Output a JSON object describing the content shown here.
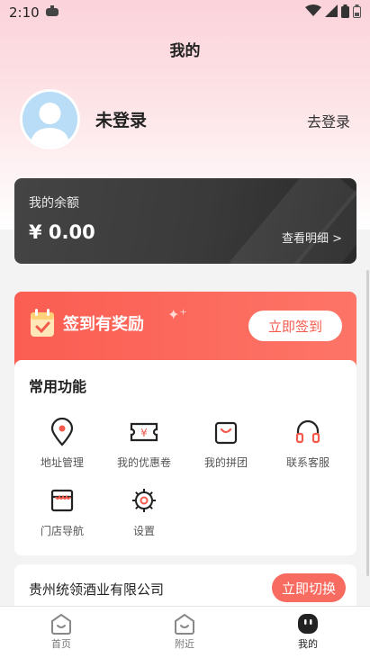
{
  "status_bar": {
    "time": "2:10"
  },
  "header": {
    "title": "我的"
  },
  "profile": {
    "username": "未登录",
    "login_link": "去登录"
  },
  "balance": {
    "label": "我的余额",
    "value": "¥ 0.00",
    "detail_link": "查看明细 >"
  },
  "checkin": {
    "title": "签到有奖励",
    "button": "立即签到"
  },
  "functions": {
    "title": "常用功能",
    "items": [
      {
        "label": "地址管理",
        "icon": "location-pin-icon"
      },
      {
        "label": "我的优惠卷",
        "icon": "coupon-icon"
      },
      {
        "label": "我的拼团",
        "icon": "shopping-bag-icon"
      },
      {
        "label": "联系客服",
        "icon": "headset-icon"
      },
      {
        "label": "门店导航",
        "icon": "store-icon"
      },
      {
        "label": "设置",
        "icon": "gear-icon"
      }
    ]
  },
  "company": {
    "name": "贵州统领酒业有限公司",
    "switch_button": "立即切换"
  },
  "bottom_nav": {
    "items": [
      {
        "label": "首页",
        "icon": "home-icon"
      },
      {
        "label": "附近",
        "icon": "nearby-icon"
      },
      {
        "label": "我的",
        "icon": "mine-icon"
      }
    ],
    "active_label": "我的"
  },
  "colors": {
    "accent": "#f35a4c",
    "card_dark": "#3a3a3a",
    "header_pink": "#fbd3da"
  }
}
